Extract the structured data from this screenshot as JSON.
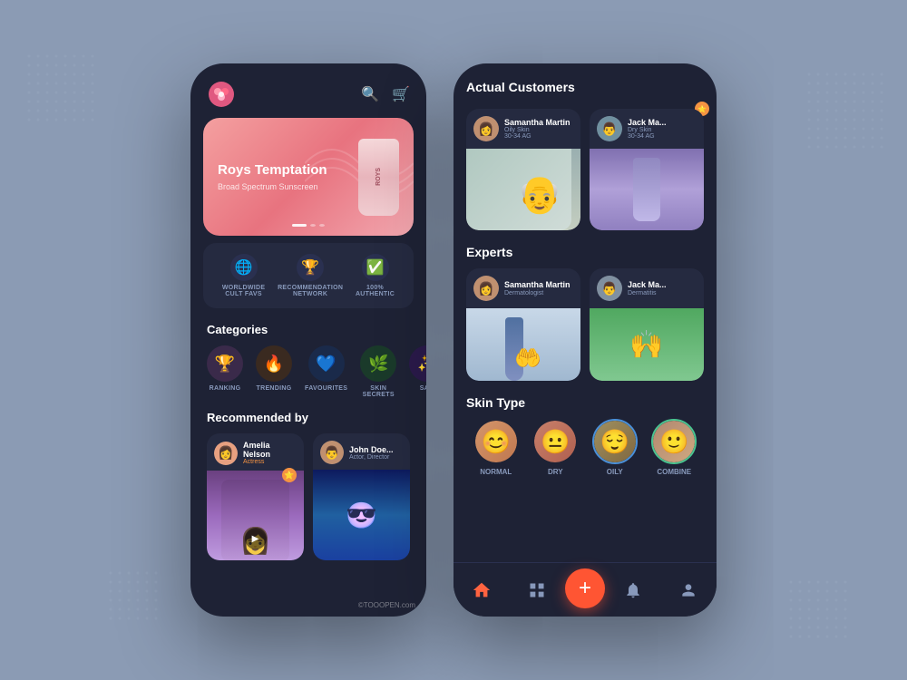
{
  "background": "#8b9bb4",
  "left_phone": {
    "header": {
      "search_icon": "🔍",
      "cart_icon": "🛒"
    },
    "hero": {
      "title": "Roys Temptation",
      "subtitle": "Broad Spectrum Sunscreen",
      "product_label": "ROYS"
    },
    "features": [
      {
        "icon": "🌐",
        "label": "WORLDWIDE\nCULT FAVS"
      },
      {
        "icon": "🏆",
        "label": "RECOMMENDATION\nNETWORK"
      },
      {
        "icon": "✅",
        "label": "100%\nAUTHENTIC"
      }
    ],
    "categories_title": "Categories",
    "categories": [
      {
        "icon": "🏆",
        "label": "RANKING",
        "bg": "#3a2a4a"
      },
      {
        "icon": "🔥",
        "label": "TRENDING",
        "bg": "#3a2a20"
      },
      {
        "icon": "💙",
        "label": "FAVOURITES",
        "bg": "#1a2a4a"
      },
      {
        "icon": "🌿",
        "label": "SKIN SECRETS",
        "bg": "#1a3a2a"
      },
      {
        "icon": "✨",
        "label": "SA...",
        "bg": "#2a1a4a"
      }
    ],
    "recommended_title": "Recommended by",
    "recommenders": [
      {
        "name": "Amelia Nelson",
        "role": "Actress",
        "avatar_bg": "#c09060"
      },
      {
        "name": "John Doe",
        "role": "Actor, Director",
        "avatar_bg": "#806040"
      }
    ]
  },
  "right_phone": {
    "actual_customers_title": "Actual Customers",
    "customers": [
      {
        "name": "Samantha Martin",
        "skin": "Oily Skin",
        "age": "30-34 AG"
      },
      {
        "name": "Jack Ma...",
        "skin": "Dry Skin",
        "age": "30-34 AG"
      }
    ],
    "experts_title": "Experts",
    "experts": [
      {
        "name": "Samantha Martin",
        "role": "Dermatologist"
      },
      {
        "name": "Jack Ma...",
        "role": "Dermatitis"
      }
    ],
    "skin_type_title": "Skin Type",
    "skin_types": [
      {
        "label": "NORMAL"
      },
      {
        "label": "DRY"
      },
      {
        "label": "OILY"
      },
      {
        "label": "COMBINE"
      }
    ],
    "nav": {
      "home": "⌂",
      "grid": "⊞",
      "add": "+",
      "bell": "🔔",
      "user": "👤"
    }
  }
}
